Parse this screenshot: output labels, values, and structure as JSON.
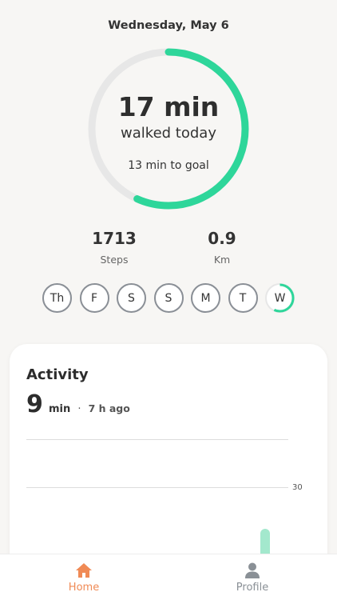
{
  "header": {
    "date": "Wednesday, May 6"
  },
  "ring": {
    "minutes": "17 min",
    "subtitle": "walked today",
    "goal_text": "13 min to goal",
    "progress": 0.567,
    "color": "#2ed69a",
    "track_color": "#e7e7e7"
  },
  "stats": [
    {
      "value": "1713",
      "label": "Steps"
    },
    {
      "value": "0.9",
      "label": "Km"
    }
  ],
  "days": [
    {
      "label": "Th",
      "progress": 0
    },
    {
      "label": "F",
      "progress": 0
    },
    {
      "label": "S",
      "progress": 0
    },
    {
      "label": "S",
      "progress": 0
    },
    {
      "label": "M",
      "progress": 0
    },
    {
      "label": "T",
      "progress": 0
    },
    {
      "label": "W",
      "progress": 0.57
    }
  ],
  "activity": {
    "title": "Activity",
    "value": "9",
    "unit": "min",
    "separator": "·",
    "ago": "7 h ago",
    "axis_label": "30"
  },
  "tabs": [
    {
      "label": "Home",
      "icon": "home-icon",
      "active": true,
      "color": "#f08a55"
    },
    {
      "label": "Profile",
      "icon": "person-icon",
      "active": false,
      "color": "#8a9096"
    }
  ]
}
